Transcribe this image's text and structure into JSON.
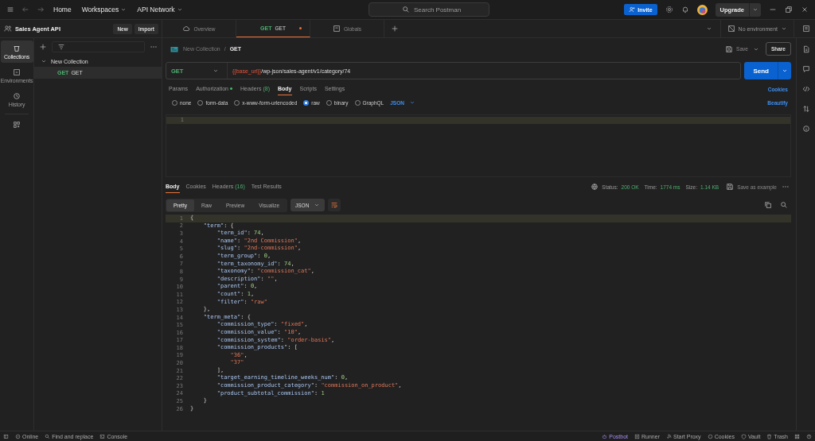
{
  "titlebar": {
    "nav": [
      {
        "label": "Home",
        "dropdown": false
      },
      {
        "label": "Workspaces",
        "dropdown": true
      },
      {
        "label": "API Network",
        "dropdown": true
      }
    ],
    "search": {
      "placeholder": "Search Postman"
    },
    "invite": "Invite",
    "upgrade": "Upgrade"
  },
  "workspace": {
    "name": "Sales Agent API",
    "buttons": [
      "New",
      "Import"
    ]
  },
  "rail": [
    {
      "kind": "collections",
      "label": "Collections",
      "selected": true
    },
    {
      "kind": "environments",
      "label": "Environments",
      "selected": false
    },
    {
      "kind": "history",
      "label": "History",
      "selected": false
    }
  ],
  "tree": [
    {
      "label": "New Collection",
      "expanded": true,
      "children": [
        {
          "method": "GET",
          "label": "GET",
          "selected": true
        }
      ]
    }
  ],
  "tabs": [
    {
      "kind": "overview",
      "label": "Overview",
      "selected": false,
      "unsaved": false
    },
    {
      "kind": "request",
      "method": "GET",
      "label": "GET",
      "selected": true,
      "unsaved": true
    },
    {
      "kind": "globals",
      "label": "Globals",
      "selected": false,
      "unsaved": false
    }
  ],
  "environment": "No environment",
  "breadcrumb": {
    "collection": "New Collection",
    "separator": "/",
    "request": "GET"
  },
  "save": "Save",
  "share": "Share",
  "request": {
    "method": "GET",
    "url_variable": "{{base_url}}",
    "url_path": "/wp-json/sales-agent/v1/category/74",
    "send": "Send"
  },
  "request_tabs": [
    {
      "label": "Params",
      "selected": false,
      "indicator": false
    },
    {
      "label": "Authorization",
      "selected": false,
      "indicator": true
    },
    {
      "label": "Headers",
      "count": "(8)",
      "selected": false,
      "indicator": false
    },
    {
      "label": "Body",
      "selected": true,
      "indicator": false
    },
    {
      "label": "Scripts",
      "selected": false,
      "indicator": false
    },
    {
      "label": "Settings",
      "selected": false,
      "indicator": false
    }
  ],
  "cookies_link": "Cookies",
  "body_types": [
    {
      "label": "none",
      "selected": false
    },
    {
      "label": "form-data",
      "selected": false
    },
    {
      "label": "x-www-form-urlencoded",
      "selected": false
    },
    {
      "label": "raw",
      "selected": true
    },
    {
      "label": "binary",
      "selected": false
    },
    {
      "label": "GraphQL",
      "selected": false
    }
  ],
  "body_format": "JSON",
  "beautify": "Beautify",
  "request_editor": {
    "line_numbers": [
      "1"
    ]
  },
  "response_tabs": [
    {
      "label": "Body",
      "selected": true
    },
    {
      "label": "Cookies",
      "selected": false
    },
    {
      "label": "Headers",
      "count": "(16)",
      "selected": false
    },
    {
      "label": "Test Results",
      "selected": false
    }
  ],
  "response_meta": {
    "status_label": "Status:",
    "status": "200 OK",
    "time_label": "Time:",
    "time": "1774 ms",
    "size_label": "Size:",
    "size": "1.14 KB",
    "save_example": "Save as example"
  },
  "view_modes": [
    {
      "label": "Pretty",
      "selected": true
    },
    {
      "label": "Raw",
      "selected": false
    },
    {
      "label": "Preview",
      "selected": false
    },
    {
      "label": "Visualize",
      "selected": false
    }
  ],
  "response_format": "JSON",
  "response_lines": [
    {
      "num": "1",
      "tokens": [
        {
          "kind": "punct",
          "text": "{"
        }
      ]
    },
    {
      "num": "2",
      "tokens": [
        {
          "kind": "key",
          "text": "    \"term\""
        },
        {
          "kind": "punct",
          "text": ": {"
        }
      ]
    },
    {
      "num": "3",
      "tokens": [
        {
          "kind": "key",
          "text": "        \"term_id\""
        },
        {
          "kind": "punct",
          "text": ": "
        },
        {
          "kind": "number",
          "text": "74"
        },
        {
          "kind": "punct",
          "text": ","
        }
      ]
    },
    {
      "num": "4",
      "tokens": [
        {
          "kind": "key",
          "text": "        \"name\""
        },
        {
          "kind": "punct",
          "text": ": "
        },
        {
          "kind": "string",
          "text": "\"2nd Commission\""
        },
        {
          "kind": "punct",
          "text": ","
        }
      ]
    },
    {
      "num": "5",
      "tokens": [
        {
          "kind": "key",
          "text": "        \"slug\""
        },
        {
          "kind": "punct",
          "text": ": "
        },
        {
          "kind": "string",
          "text": "\"2nd-commission\""
        },
        {
          "kind": "punct",
          "text": ","
        }
      ]
    },
    {
      "num": "6",
      "tokens": [
        {
          "kind": "key",
          "text": "        \"term_group\""
        },
        {
          "kind": "punct",
          "text": ": "
        },
        {
          "kind": "number",
          "text": "0"
        },
        {
          "kind": "punct",
          "text": ","
        }
      ]
    },
    {
      "num": "7",
      "tokens": [
        {
          "kind": "key",
          "text": "        \"term_taxonomy_id\""
        },
        {
          "kind": "punct",
          "text": ": "
        },
        {
          "kind": "number",
          "text": "74"
        },
        {
          "kind": "punct",
          "text": ","
        }
      ]
    },
    {
      "num": "8",
      "tokens": [
        {
          "kind": "key",
          "text": "        \"taxonomy\""
        },
        {
          "kind": "punct",
          "text": ": "
        },
        {
          "kind": "string",
          "text": "\"commission_cat\""
        },
        {
          "kind": "punct",
          "text": ","
        }
      ]
    },
    {
      "num": "9",
      "tokens": [
        {
          "kind": "key",
          "text": "        \"description\""
        },
        {
          "kind": "punct",
          "text": ": "
        },
        {
          "kind": "string",
          "text": "\"\""
        },
        {
          "kind": "punct",
          "text": ","
        }
      ]
    },
    {
      "num": "10",
      "tokens": [
        {
          "kind": "key",
          "text": "        \"parent\""
        },
        {
          "kind": "punct",
          "text": ": "
        },
        {
          "kind": "number",
          "text": "0"
        },
        {
          "kind": "punct",
          "text": ","
        }
      ]
    },
    {
      "num": "11",
      "tokens": [
        {
          "kind": "key",
          "text": "        \"count\""
        },
        {
          "kind": "punct",
          "text": ": "
        },
        {
          "kind": "number",
          "text": "1"
        },
        {
          "kind": "punct",
          "text": ","
        }
      ]
    },
    {
      "num": "12",
      "tokens": [
        {
          "kind": "key",
          "text": "        \"filter\""
        },
        {
          "kind": "punct",
          "text": ": "
        },
        {
          "kind": "string",
          "text": "\"raw\""
        }
      ]
    },
    {
      "num": "13",
      "tokens": [
        {
          "kind": "punct",
          "text": "    },"
        }
      ]
    },
    {
      "num": "14",
      "tokens": [
        {
          "kind": "key",
          "text": "    \"term_meta\""
        },
        {
          "kind": "punct",
          "text": ": {"
        }
      ]
    },
    {
      "num": "15",
      "tokens": [
        {
          "kind": "key",
          "text": "        \"commission_type\""
        },
        {
          "kind": "punct",
          "text": ": "
        },
        {
          "kind": "string",
          "text": "\"fixed\""
        },
        {
          "kind": "punct",
          "text": ","
        }
      ]
    },
    {
      "num": "16",
      "tokens": [
        {
          "kind": "key",
          "text": "        \"commission_value\""
        },
        {
          "kind": "punct",
          "text": ": "
        },
        {
          "kind": "string",
          "text": "\"10\""
        },
        {
          "kind": "punct",
          "text": ","
        }
      ]
    },
    {
      "num": "17",
      "tokens": [
        {
          "kind": "key",
          "text": "        \"commission_system\""
        },
        {
          "kind": "punct",
          "text": ": "
        },
        {
          "kind": "string",
          "text": "\"order-basis\""
        },
        {
          "kind": "punct",
          "text": ","
        }
      ]
    },
    {
      "num": "18",
      "tokens": [
        {
          "kind": "key",
          "text": "        \"commission_products\""
        },
        {
          "kind": "punct",
          "text": ": ["
        }
      ]
    },
    {
      "num": "19",
      "tokens": [
        {
          "kind": "string",
          "text": "            \"36\""
        },
        {
          "kind": "punct",
          "text": ","
        }
      ]
    },
    {
      "num": "20",
      "tokens": [
        {
          "kind": "string",
          "text": "            \"37\""
        }
      ]
    },
    {
      "num": "21",
      "tokens": [
        {
          "kind": "punct",
          "text": "        ],"
        }
      ]
    },
    {
      "num": "22",
      "tokens": [
        {
          "kind": "key",
          "text": "        \"target_earning_timeline_weeks_num\""
        },
        {
          "kind": "punct",
          "text": ": "
        },
        {
          "kind": "number",
          "text": "0"
        },
        {
          "kind": "punct",
          "text": ","
        }
      ]
    },
    {
      "num": "23",
      "tokens": [
        {
          "kind": "key",
          "text": "        \"commission_product_category\""
        },
        {
          "kind": "punct",
          "text": ": "
        },
        {
          "kind": "string",
          "text": "\"commission_on_product\""
        },
        {
          "kind": "punct",
          "text": ","
        }
      ]
    },
    {
      "num": "24",
      "tokens": [
        {
          "kind": "key",
          "text": "        \"product_subtotal_commission\""
        },
        {
          "kind": "punct",
          "text": ": "
        },
        {
          "kind": "number",
          "text": "1"
        }
      ]
    },
    {
      "num": "25",
      "tokens": [
        {
          "kind": "punct",
          "text": "    }"
        }
      ]
    },
    {
      "num": "26",
      "tokens": [
        {
          "kind": "punct",
          "text": "}"
        }
      ]
    }
  ],
  "status_bar": {
    "left": [
      {
        "kind": "online",
        "label": "Online"
      },
      {
        "kind": "find",
        "label": "Find and replace"
      },
      {
        "kind": "console",
        "label": "Console"
      }
    ],
    "right": [
      {
        "kind": "postbot",
        "label": "Postbot"
      },
      {
        "kind": "runner",
        "label": "Runner"
      },
      {
        "kind": "proxy",
        "label": "Start Proxy"
      },
      {
        "kind": "cookies",
        "label": "Cookies"
      },
      {
        "kind": "vault",
        "label": "Vault"
      },
      {
        "kind": "trash",
        "label": "Trash"
      }
    ]
  }
}
